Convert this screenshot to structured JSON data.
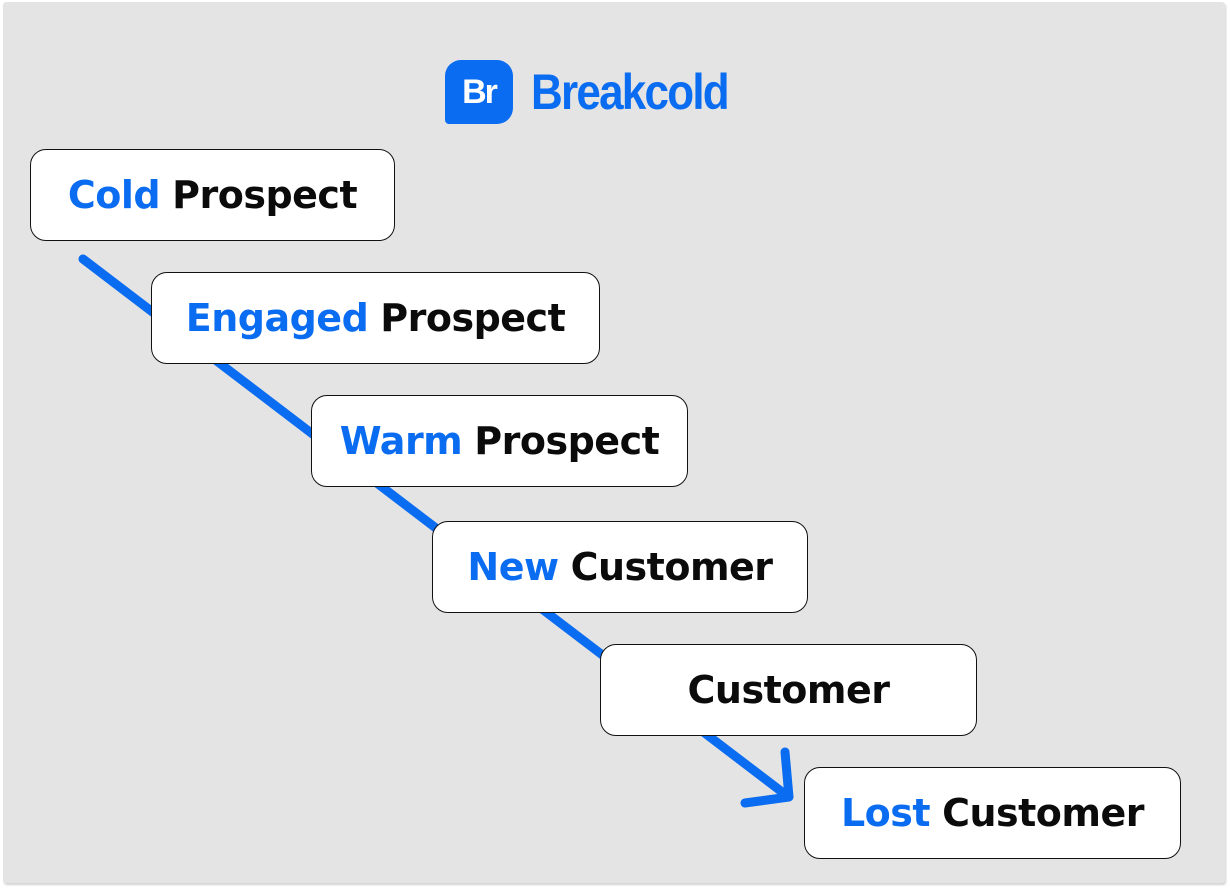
{
  "brand": {
    "mark": "Br",
    "name": "Breakcold",
    "color": "#0a6cf0"
  },
  "stages": [
    {
      "accent": "Cold",
      "rest": "Prospect"
    },
    {
      "accent": "Engaged",
      "rest": "Prospect"
    },
    {
      "accent": "Warm",
      "rest": "Prospect"
    },
    {
      "accent": "New",
      "rest": "Customer"
    },
    {
      "accent": "",
      "rest": "Customer"
    },
    {
      "accent": "Lost",
      "rest": "Customer"
    }
  ],
  "colors": {
    "accent": "#0a6cf0",
    "text": "#0b0b0b",
    "background": "#e4e4e4",
    "box": "#ffffff"
  }
}
